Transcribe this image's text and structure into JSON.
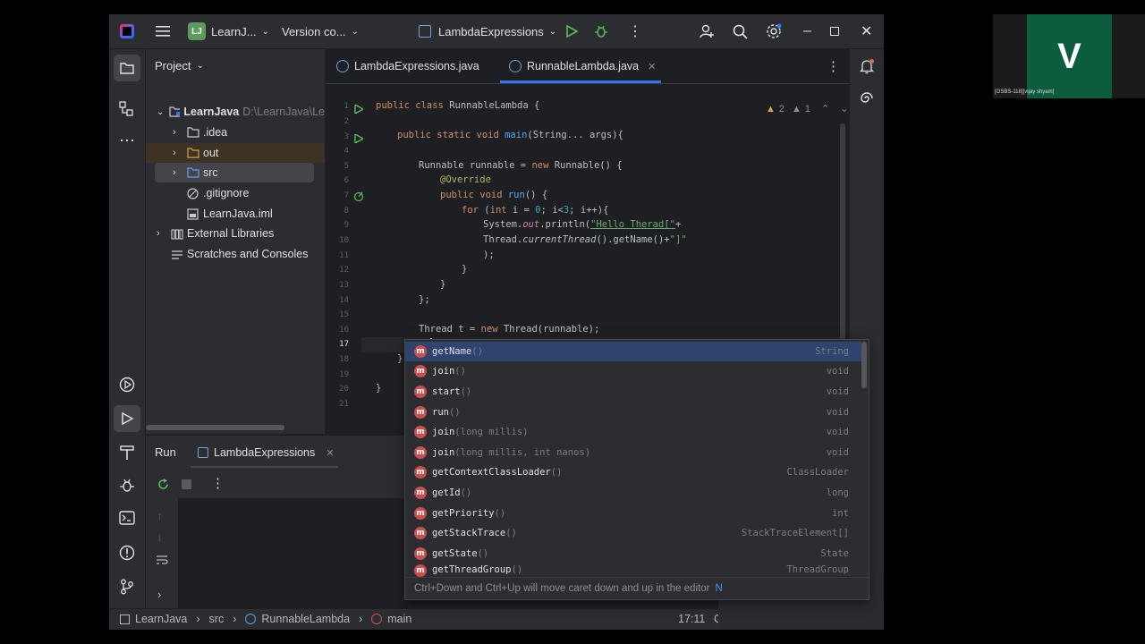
{
  "titlebar": {
    "project_badge": "LJ",
    "project_name": "LearnJ...",
    "vcs": "Version co...",
    "run_config": "LambdaExpressions"
  },
  "project_panel": {
    "title": "Project",
    "items": [
      {
        "label": "LearnJava",
        "extra": "D:\\LearnJava\\Le"
      },
      {
        "label": ".idea"
      },
      {
        "label": "out"
      },
      {
        "label": "src"
      },
      {
        "label": ".gitignore"
      },
      {
        "label": "LearnJava.iml"
      },
      {
        "label": "External Libraries"
      },
      {
        "label": "Scratches and Consoles"
      }
    ]
  },
  "editor": {
    "tabs": [
      "LambdaExpressions.java",
      "RunnableLambda.java"
    ],
    "inspections": {
      "warnings": "2",
      "weak": "1"
    },
    "line_numbers": [
      "1",
      "2",
      "3",
      "4",
      "5",
      "6",
      "7",
      "8",
      "9",
      "10",
      "11",
      "12",
      "13",
      "14",
      "15",
      "16",
      "17",
      "18",
      "19",
      "20",
      "21"
    ],
    "code": {
      "l1_kw": "public class ",
      "l1_rest": "RunnableLambda {",
      "l3_kw": "public static void ",
      "l3_fn": "main",
      "l3_rest": "(String... args){",
      "l5_a": "Runnable runnable = ",
      "l5_kw": "new ",
      "l5_b": "Runnable() {",
      "l6": "@Override",
      "l7_kw": "public void ",
      "l7_fn": "run",
      "l7_rest": "() {",
      "l8_kw": "for ",
      "l8_a": "(",
      "l8_kw2": "int ",
      "l8_b": "i = ",
      "l8_n1": "0",
      "l8_c": "; i<",
      "l8_n2": "3",
      "l8_d": "; i++){",
      "l9_a": "System.",
      "l9_it": "out",
      "l9_b": ".println(",
      "l9_str": "\"Hello Therad[\"",
      "l9_c": "+",
      "l10_a": "Thread.",
      "l10_it": "currentThread",
      "l10_b": "().getName()+",
      "l10_str": "\"]\"",
      "l11": ");",
      "l12": "}",
      "l13": "}",
      "l14": "};",
      "l16_a": "Thread t = ",
      "l16_kw": "new ",
      "l16_b": "Thread(runnable);",
      "l17": "t.",
      "l18": "}",
      "l20": "}"
    }
  },
  "completion": {
    "items": [
      {
        "name": "getName",
        "params": "()",
        "type": "String"
      },
      {
        "name": "join",
        "params": "()",
        "type": "void"
      },
      {
        "name": "start",
        "params": "()",
        "type": "void"
      },
      {
        "name": "run",
        "params": "()",
        "type": "void"
      },
      {
        "name": "join",
        "params": "(long millis)",
        "type": "void"
      },
      {
        "name": "join",
        "params": "(long millis, int nanos)",
        "type": "void"
      },
      {
        "name": "getContextClassLoader",
        "params": "()",
        "type": "ClassLoader"
      },
      {
        "name": "getId",
        "params": "()",
        "type": "long"
      },
      {
        "name": "getPriority",
        "params": "()",
        "type": "int"
      },
      {
        "name": "getStackTrace",
        "params": "()",
        "type": "StackTraceElement[]"
      },
      {
        "name": "getState",
        "params": "()",
        "type": "State"
      },
      {
        "name": "getThreadGroup",
        "params": "()",
        "type": "ThreadGroup"
      }
    ],
    "footer": "Ctrl+Down and Ctrl+Up will move caret down and up in the editor",
    "footer_suffix": "N"
  },
  "run_panel": {
    "title": "Run",
    "tab": "LambdaExpressions"
  },
  "statusbar": {
    "crumbs": [
      "LearnJava",
      "src",
      "RunnableLambda",
      "main"
    ],
    "position": "17:11",
    "extra": "C"
  },
  "participant": {
    "initial": "V",
    "name": "[OSBS-118][vijay shyam]"
  },
  "colors": {
    "accent": "#3574f0",
    "selection": "#2e436e",
    "avatar": "#0c5c3e",
    "method_icon": "#c94f4f",
    "run_green": "#5fb865"
  }
}
